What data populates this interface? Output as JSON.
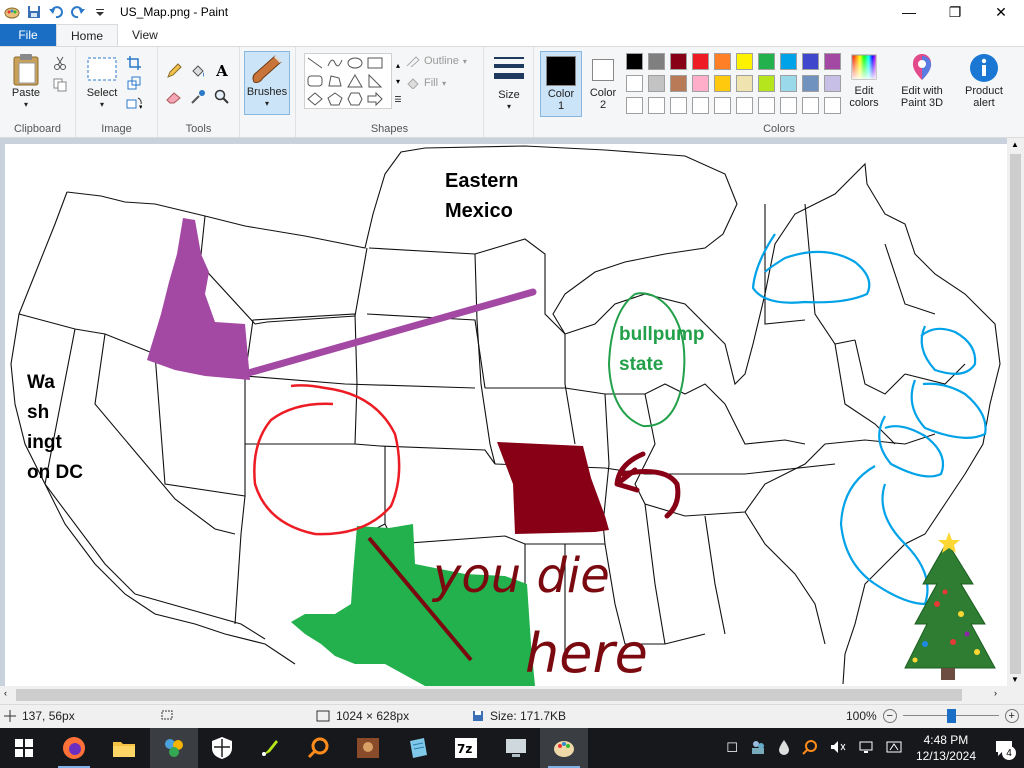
{
  "window": {
    "title": "US_Map.png - Paint",
    "minimize": "—",
    "maximize": "❐",
    "close": "✕"
  },
  "tabs": {
    "file": "File",
    "home": "Home",
    "view": "View"
  },
  "ribbon": {
    "clipboard": {
      "label": "Clipboard",
      "paste": "Paste"
    },
    "image": {
      "label": "Image",
      "select": "Select"
    },
    "tools": {
      "label": "Tools"
    },
    "brushes": {
      "label": "Brushes"
    },
    "shapes": {
      "label": "Shapes",
      "outline": "Outline",
      "fill": "Fill"
    },
    "size": {
      "label": "Size"
    },
    "colors": {
      "label": "Colors",
      "color1": "Color 1",
      "color2": "Color 2",
      "edit_colors": "Edit colors",
      "edit_with_paint3d": "Edit with Paint 3D",
      "product_alert": "Product alert",
      "color1_value": "#000000",
      "color2_value": "#ffffff",
      "palette_row1": [
        "#000000",
        "#7f7f7f",
        "#880015",
        "#ed1c24",
        "#ff7f27",
        "#fff200",
        "#22b14c",
        "#00a2e8",
        "#3f48cc",
        "#a349a4"
      ],
      "palette_row2": [
        "#ffffff",
        "#c3c3c3",
        "#b97a57",
        "#ffaec9",
        "#ffc90e",
        "#efe4b0",
        "#b5e61d",
        "#99d9ea",
        "#7092be",
        "#c8bfe7"
      ],
      "palette_row3": [
        "#ffffff",
        "#ffffff",
        "#ffffff",
        "#ffffff",
        "#ffffff",
        "#ffffff",
        "#ffffff",
        "#ffffff",
        "#ffffff",
        "#ffffff"
      ]
    }
  },
  "canvas": {
    "label_eastern": "Eastern\nMexico",
    "label_dc": "Wa\nsh\ningt\non  DC",
    "label_bullpump": "bullpump\nstate",
    "label_youdie": "you die",
    "label_here": "here",
    "idaho_color": "#a349a4",
    "missouri_color": "#880015",
    "texas_color": "#22b14c",
    "circle_color": "#ed1c24",
    "scribble_color": "#00a2e8"
  },
  "status": {
    "cursor": "137, 56px",
    "image_size": "1024 × 628px",
    "file_size": "Size: 171.7KB",
    "zoom": "100%",
    "zoom_level": 0.5
  },
  "taskbar": {
    "time": "4:48 PM",
    "date": "12/13/2024",
    "notifications": "4"
  }
}
